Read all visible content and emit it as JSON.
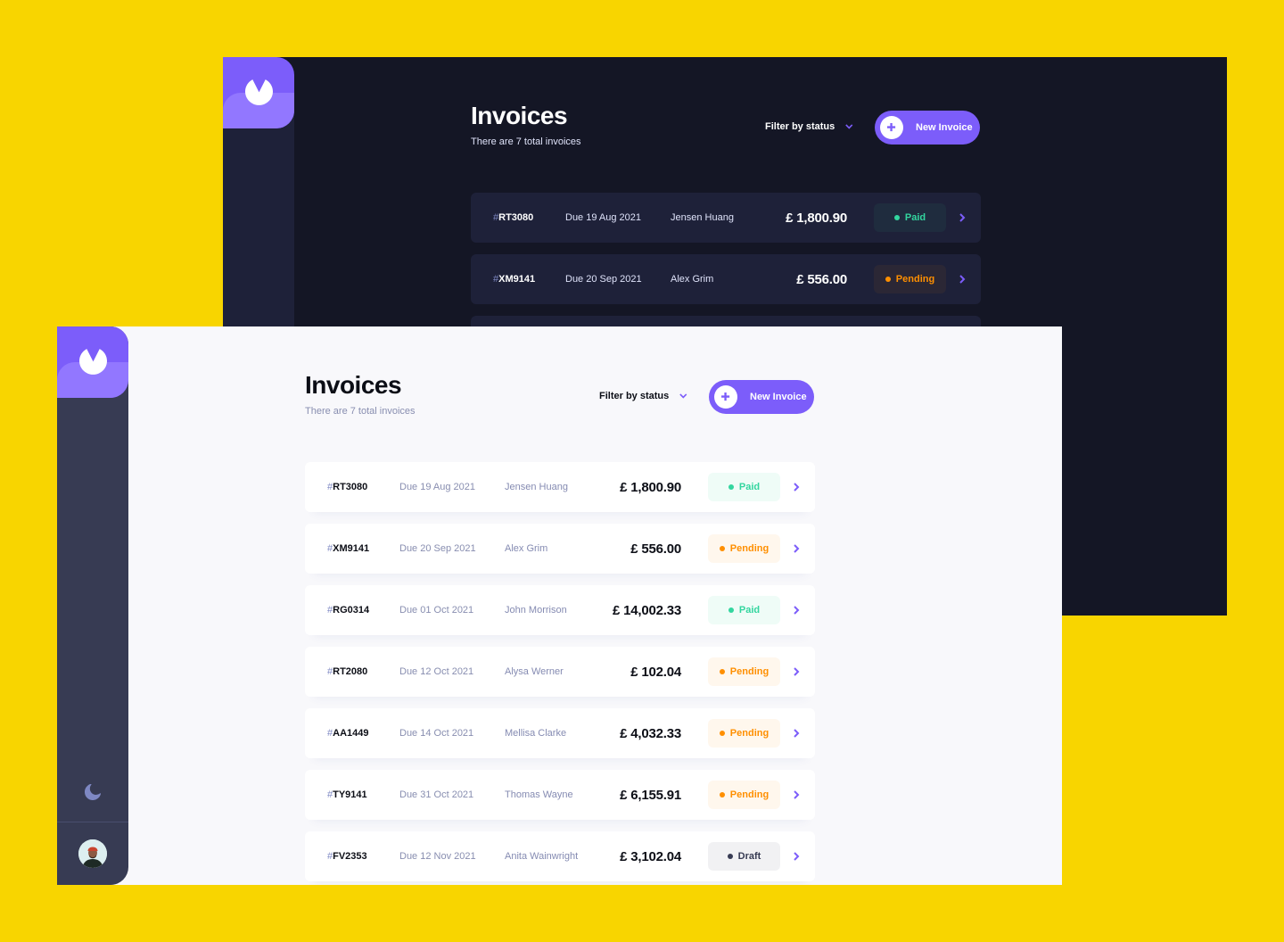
{
  "colors": {
    "background": "#F8D500",
    "accent": "#7C5DFA",
    "accent_light": "#9277FF",
    "paid": "#33D69F",
    "pending": "#FF8F00",
    "draft": "#373B53"
  },
  "icons": {
    "logo": "logo-mark-icon",
    "theme": "moon-icon",
    "filter": "chevron-down-icon",
    "new": "plus-icon",
    "row": "chevron-right-icon"
  },
  "dark_app": {
    "title": "Invoices",
    "subtitle": "There are 7 total invoices",
    "filter_label": "Filter by status",
    "new_button_label": "New Invoice",
    "invoices": [
      {
        "hash": "#",
        "id": "RT3080",
        "due": "Due  19 Aug 2021",
        "client": "Jensen Huang",
        "amount": "£ 1,800.90",
        "status": "Paid",
        "status_key": "paid"
      },
      {
        "hash": "#",
        "id": "XM9141",
        "due": "Due  20 Sep 2021",
        "client": "Alex Grim",
        "amount": "£ 556.00",
        "status": "Pending",
        "status_key": "pending"
      }
    ]
  },
  "light_app": {
    "title": "Invoices",
    "subtitle": "There are 7 total invoices",
    "filter_label": "Filter by status",
    "new_button_label": "New Invoice",
    "invoices": [
      {
        "hash": "#",
        "id": "RT3080",
        "due": "Due  19 Aug 2021",
        "client": "Jensen Huang",
        "amount": "£ 1,800.90",
        "status": "Paid",
        "status_key": "paid"
      },
      {
        "hash": "#",
        "id": "XM9141",
        "due": "Due  20 Sep 2021",
        "client": "Alex Grim",
        "amount": "£ 556.00",
        "status": "Pending",
        "status_key": "pending"
      },
      {
        "hash": "#",
        "id": "RG0314",
        "due": "Due  01 Oct 2021",
        "client": "John Morrison",
        "amount": "£ 14,002.33",
        "status": "Paid",
        "status_key": "paid"
      },
      {
        "hash": "#",
        "id": "RT2080",
        "due": "Due  12 Oct 2021",
        "client": "Alysa Werner",
        "amount": "£ 102.04",
        "status": "Pending",
        "status_key": "pending"
      },
      {
        "hash": "#",
        "id": "AA1449",
        "due": "Due  14 Oct 2021",
        "client": "Mellisa Clarke",
        "amount": "£ 4,032.33",
        "status": "Pending",
        "status_key": "pending"
      },
      {
        "hash": "#",
        "id": "TY9141",
        "due": "Due  31 Oct 2021",
        "client": "Thomas Wayne",
        "amount": "£ 6,155.91",
        "status": "Pending",
        "status_key": "pending"
      },
      {
        "hash": "#",
        "id": "FV2353",
        "due": "Due  12 Nov 2021",
        "client": "Anita Wainwright",
        "amount": "£ 3,102.04",
        "status": "Draft",
        "status_key": "draft"
      }
    ]
  }
}
